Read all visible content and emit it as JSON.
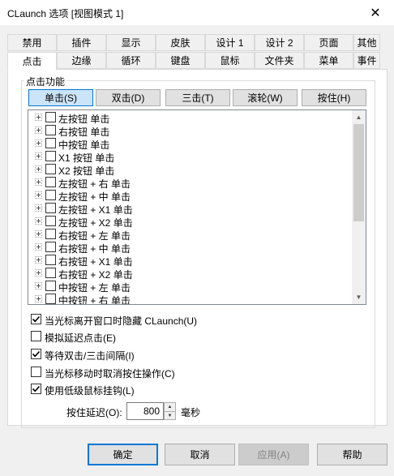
{
  "window": {
    "title": "CLaunch 选项 [视图模式 1]",
    "close_glyph": "✕"
  },
  "tabs_row1": [
    "禁用",
    "插件",
    "显示",
    "皮肤",
    "设计 1",
    "设计 2",
    "页面",
    "其他"
  ],
  "tabs_row2": [
    "点击",
    "边缘",
    "循环",
    "键盘",
    "鼠标",
    "文件夹",
    "菜单",
    "事件"
  ],
  "active_tab": "点击",
  "group": {
    "label": "点击功能"
  },
  "click_types": [
    "单击(S)",
    "双击(D)",
    "三击(T)",
    "滚轮(W)",
    "按住(H)"
  ],
  "active_click_type": "单击(S)",
  "tree_items": [
    "左按钮 单击",
    "右按钮 单击",
    "中按钮 单击",
    "X1 按钮 单击",
    "X2 按钮 单击",
    "左按钮 + 右 单击",
    "左按钮 + 中 单击",
    "左按钮 + X1 单击",
    "左按钮 + X2 单击",
    "右按钮 + 左 单击",
    "右按钮 + 中 单击",
    "右按钮 + X1 单击",
    "右按钮 + X2 单击",
    "中按钮 + 左 单击",
    "中按钮 + 右 单击"
  ],
  "options": [
    {
      "label": "当光标离开窗口时隐藏 CLaunch(U)",
      "checked": true
    },
    {
      "label": "模拟延迟点击(E)",
      "checked": false
    },
    {
      "label": "等待双击/三击间隔(I)",
      "checked": true
    },
    {
      "label": "当光标移动时取消按住操作(C)",
      "checked": false
    },
    {
      "label": "使用低级鼠标挂钩(L)",
      "checked": true
    }
  ],
  "hold_delay": {
    "label": "按住延迟(O):",
    "value": "800",
    "unit": "毫秒"
  },
  "buttons": {
    "ok": "确定",
    "cancel": "取消",
    "apply": "应用(A)",
    "help": "帮助"
  }
}
